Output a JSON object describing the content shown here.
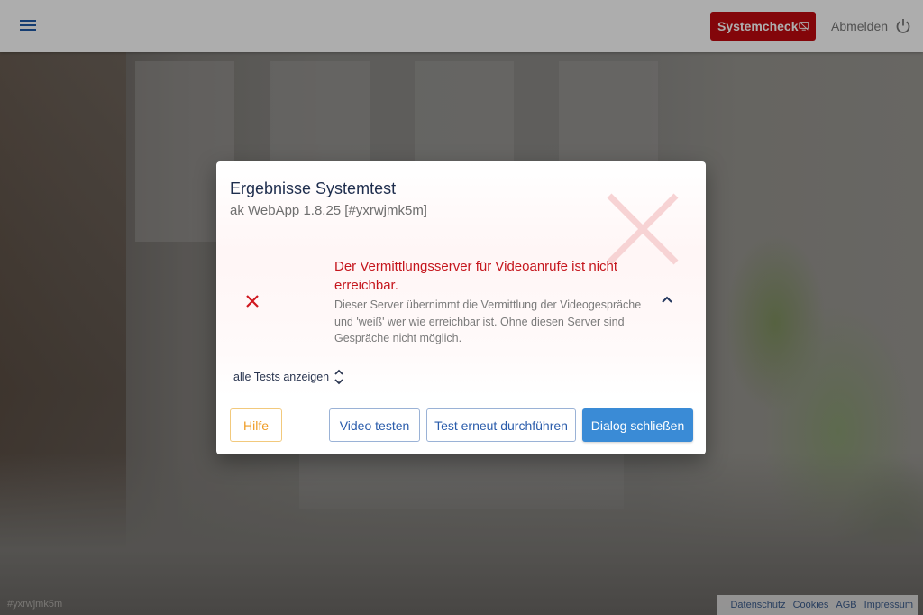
{
  "topbar": {
    "systemcheck_label": "Systemcheck",
    "logout_label": "Abmelden"
  },
  "dialog": {
    "title": "Ergebnisse Systemtest",
    "subtitle": "ak WebApp 1.8.25 [#yxrwjmk5m]",
    "error": {
      "title": "Der Vermittlungsserver für Videoanrufe ist nicht erreichbar.",
      "description": "Dieser Server übernimmt die Vermittlung der Videogespräche und 'weiß' wer wie erreichbar ist. Ohne diesen Server sind Gespräche nicht möglich."
    },
    "show_all_label": "alle Tests anzeigen",
    "buttons": {
      "help": "Hilfe",
      "video": "Video testen",
      "retest": "Test erneut durchführen",
      "close": "Dialog schließen"
    }
  },
  "footer": {
    "build_id": "#yxrwjmk5m",
    "links": [
      "Datenschutz",
      "Cookies",
      "AGB",
      "Impressum"
    ]
  },
  "colors": {
    "primary": "#3a8bd6",
    "error": "#c5161d",
    "systemcheck": "#c20a10",
    "help": "#ef9c25"
  },
  "icons": {
    "menu": "hamburger-icon",
    "systemcheck": "screen-off-icon",
    "logout": "power-icon",
    "error": "close-x-icon",
    "collapse": "chevron-up-icon",
    "expand": "unfold-icon"
  }
}
